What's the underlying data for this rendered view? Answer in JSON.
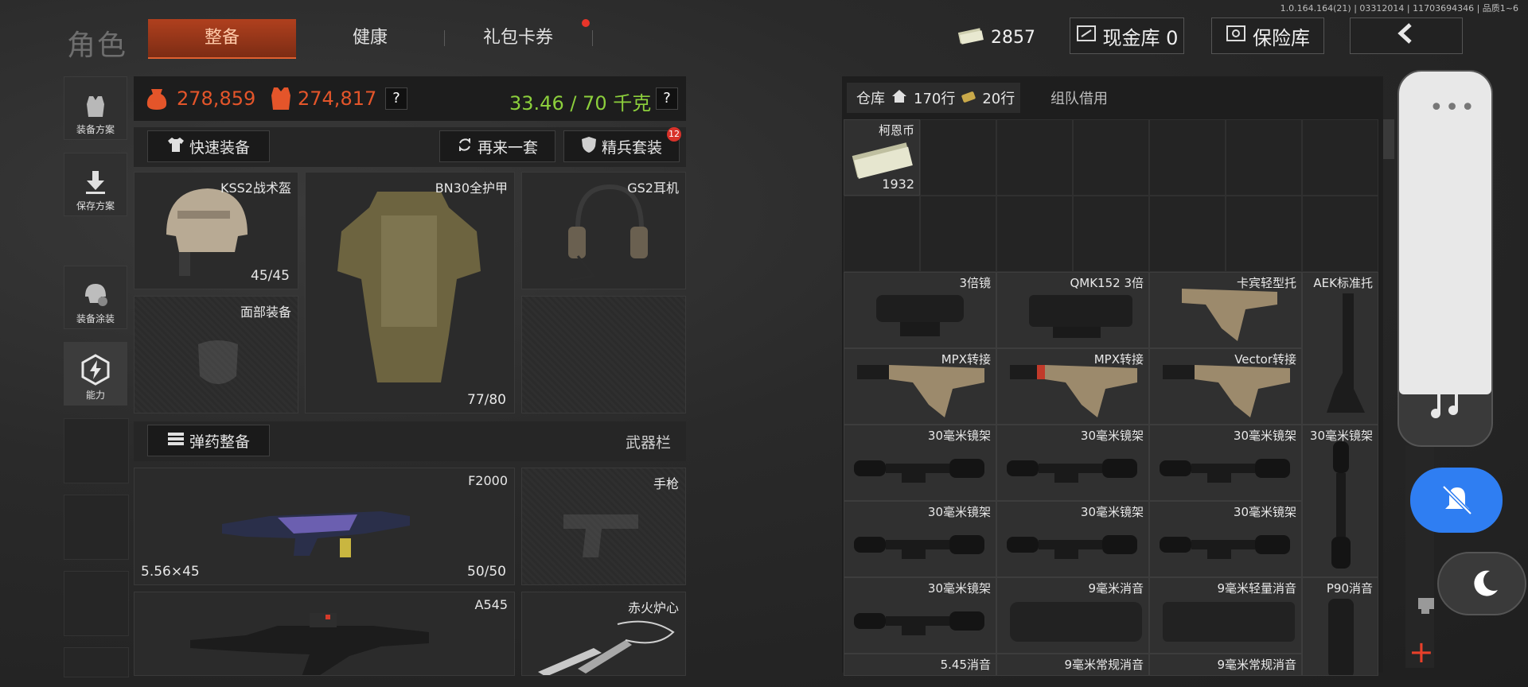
{
  "version": "1.0.164.164(21) | 03312014 | 11703694346 | 品质1~6",
  "header": {
    "title": "角色",
    "tabs": [
      {
        "label": "整备",
        "active": true
      },
      {
        "label": "健康",
        "active": false
      },
      {
        "label": "礼包卡券",
        "active": false,
        "has_dot": true
      }
    ],
    "cash_value": "2857",
    "cash_vault_label": "现金库 0",
    "safe_label": "保险库",
    "back_icon": "chevron-left-icon"
  },
  "sidebar": [
    {
      "label": "装备方案",
      "icon": "vest-icon"
    },
    {
      "label": "保存方案",
      "icon": "download-icon"
    },
    {
      "label": "装备涂装",
      "icon": "helmet-paint-icon"
    },
    {
      "label": "能力",
      "icon": "lightning-hex-icon",
      "active": true
    }
  ],
  "stats": {
    "value_1": "278,859",
    "value_2": "274,817",
    "weight": "33.46 / 70 千克",
    "help": "?"
  },
  "actions": {
    "quick_equip": "快速装备",
    "again": "再来一套",
    "elite": "精兵套装",
    "elite_badge": "12"
  },
  "slots": {
    "helmet": {
      "name": "KSS2战术盔",
      "count": "45/45"
    },
    "armor": {
      "name": "BN30全护甲",
      "count": "77/80"
    },
    "headset": {
      "name": "GS2耳机"
    },
    "face": {
      "name": "面部装备"
    },
    "ammo_btn": "弹药整备",
    "weapon_bar": "武器栏",
    "primary": {
      "name": "F2000",
      "caliber": "5.56×45",
      "count": "50/50"
    },
    "pistol": {
      "name": "手枪"
    },
    "secondary": {
      "name": "A545"
    },
    "melee": {
      "name": "赤火炉心"
    }
  },
  "warehouse": {
    "tab_label": "仓库",
    "rows": "170行",
    "extra_rows": "20行",
    "team_tab": "组队借用",
    "items": [
      {
        "name": "柯恩币",
        "count": "1932"
      },
      {
        "name": "3倍镜"
      },
      {
        "name": "QMK152 3倍"
      },
      {
        "name": "卡宾轻型托"
      },
      {
        "name": "AEK标准托"
      },
      {
        "name": "MPX转接"
      },
      {
        "name": "MPX转接"
      },
      {
        "name": "Vector转接"
      },
      {
        "name": "30毫米镜架"
      },
      {
        "name": "30毫米镜架"
      },
      {
        "name": "30毫米镜架"
      },
      {
        "name": "30毫米镜架"
      },
      {
        "name": "30毫米镜架"
      },
      {
        "name": "30毫米镜架"
      },
      {
        "name": "30毫米镜架"
      },
      {
        "name": "30毫米镜架"
      },
      {
        "name": "9毫米消音"
      },
      {
        "name": "9毫米轻量消音"
      },
      {
        "name": "P90消音"
      },
      {
        "name": "5.45消音"
      },
      {
        "name": "9毫米常规消音"
      },
      {
        "name": "9毫米常规消音"
      }
    ]
  }
}
